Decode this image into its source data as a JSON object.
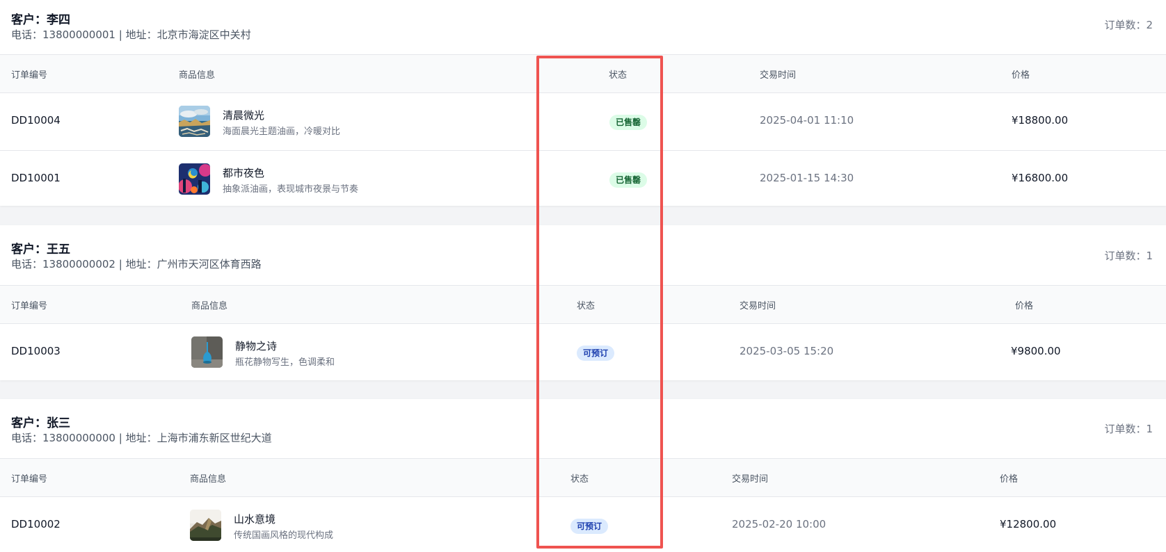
{
  "groups": [
    {
      "customer_name": "客户：李四",
      "contact": "电话：13800000001 | 地址：北京市海淀区中关村",
      "order_count": "订单数：2",
      "headers": [
        "订单编号",
        "商品信息",
        "状态",
        "交易时间",
        "价格"
      ],
      "orders": [
        {
          "id": "DD10004",
          "product_title": "清晨微光",
          "product_desc": "海面晨光主题油画，冷暖对比",
          "status": "已售罄",
          "time": "2025-04-01 11:10",
          "price": "¥18800.00"
        },
        {
          "id": "DD10001",
          "product_title": "都市夜色",
          "product_desc": "抽象派油画，表现城市夜景与节奏",
          "status": "已售罄",
          "time": "2025-01-15 14:30",
          "price": "¥16800.00"
        }
      ]
    },
    {
      "customer_name": "客户：王五",
      "contact": "电话：13800000002 | 地址：广州市天河区体育西路",
      "order_count": "订单数：1",
      "headers": [
        "订单编号",
        "商品信息",
        "状态",
        "交易时间",
        "价格"
      ],
      "orders": [
        {
          "id": "DD10003",
          "product_title": "静物之诗",
          "product_desc": "瓶花静物写生，色调柔和",
          "status": "可预订",
          "time": "2025-03-05 15:20",
          "price": "¥9800.00"
        }
      ]
    },
    {
      "customer_name": "客户：张三",
      "contact": "电话：13800000000 | 地址：上海市浦东新区世纪大道",
      "order_count": "订单数：1",
      "headers": [
        "订单编号",
        "商品信息",
        "状态",
        "交易时间",
        "价格"
      ],
      "orders": [
        {
          "id": "DD10002",
          "product_title": "山水意境",
          "product_desc": "传统国画风格的现代构成",
          "status": "可预订",
          "time": "2025-02-20 10:00",
          "price": "¥12800.00"
        }
      ]
    }
  ],
  "colors": {
    "status_sold_bg": "#dcfce7",
    "status_sold_text": "#166534",
    "status_reserve_bg": "#dbeafe",
    "status_reserve_text": "#1e40af",
    "highlight": "#ef5350"
  }
}
